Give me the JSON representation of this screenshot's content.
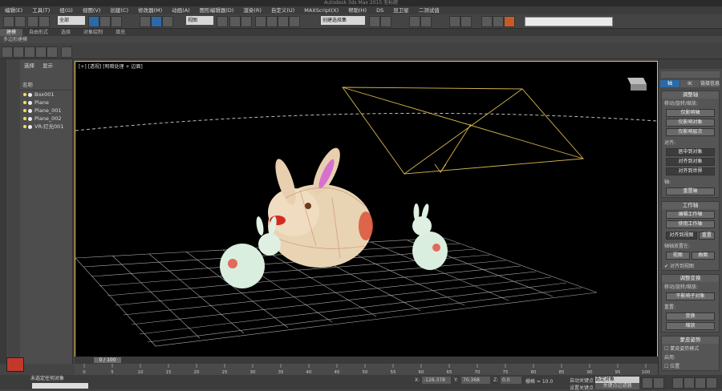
{
  "window": {
    "title": "Autodesk 3ds Max 2015   无标题"
  },
  "menu": [
    "编辑(E)",
    "工具(T)",
    "组(G)",
    "视图(V)",
    "创建(C)",
    "修改器(M)",
    "动画(A)",
    "图形编辑器(D)",
    "渲染(R)",
    "自定义(U)",
    "MAXScript(X)",
    "帮助(H)",
    "DS",
    "显卫星",
    "二测试值"
  ],
  "toolbar": {
    "selection_filter": "全部",
    "ref_coord": "视图",
    "named_set": "创建选择集"
  },
  "ribbon": {
    "tabs": [
      "建模",
      "自由形式",
      "选择",
      "对象绘制",
      "填充"
    ],
    "sub": "多边形建模"
  },
  "scene_explorer": {
    "tabs": [
      "选择",
      "显示"
    ],
    "header": "名称",
    "items": [
      "Box001",
      "Plane",
      "Plane_001",
      "Plane_002",
      "VR-灯光001"
    ]
  },
  "viewport": {
    "label": "[+] [透视] [明暗处理 + 边面]"
  },
  "command_panel": {
    "tabs": [
      "轴",
      "IK",
      "链接信息"
    ],
    "adjust_pivot": {
      "title": "调整轴",
      "move_rotate_label": "移动/旋转/缩放:",
      "buttons": [
        "仅影响轴",
        "仅影响对象",
        "仅影响层次"
      ],
      "align_label": "对齐:",
      "align_buttons": [
        "居中到对象",
        "对齐到对象",
        "对齐到世界"
      ],
      "axis_label": "轴:",
      "reset_button": "重置轴"
    },
    "working_pivot": {
      "title": "工作轴",
      "buttons": [
        "编辑工作轴",
        "使用工作轴"
      ],
      "row_buttons": [
        "对齐到视图",
        "重置"
      ],
      "place_label": "轴轴放置在:",
      "place_buttons": [
        "视图",
        "曲面"
      ],
      "check_label": "对齐到视图"
    },
    "adjust_transform": {
      "title": "调整变换",
      "move_label": "移动/旋转/缩放:",
      "child_button": "不影响子对象",
      "reset_label": "重置:",
      "transform_button": "变换",
      "scale_button": "缩放"
    },
    "skin_pose": {
      "title": "蒙皮姿势",
      "check_label": "蒙皮姿势模式",
      "enabled_label": "启用:",
      "pos_label": "位置"
    }
  },
  "timeline": {
    "frame": "0 / 100",
    "ticks": [
      "0",
      "5",
      "10",
      "15",
      "20",
      "25",
      "30",
      "35",
      "40",
      "45",
      "50",
      "55",
      "60",
      "65",
      "70",
      "75",
      "80",
      "85",
      "90",
      "95",
      "100"
    ]
  },
  "status": {
    "selection": "未选定任何对象",
    "x_label": "X:",
    "x_value": "-126.378",
    "y_label": "Y:",
    "y_value": "70.368",
    "z_label": "Z:",
    "z_value": "0.0",
    "grid": "栅格 = 10.0",
    "autokey": "自动关键点",
    "selected": "选定对象",
    "set_key": "设置关键点",
    "key_filter": "关键点过滤器"
  }
}
